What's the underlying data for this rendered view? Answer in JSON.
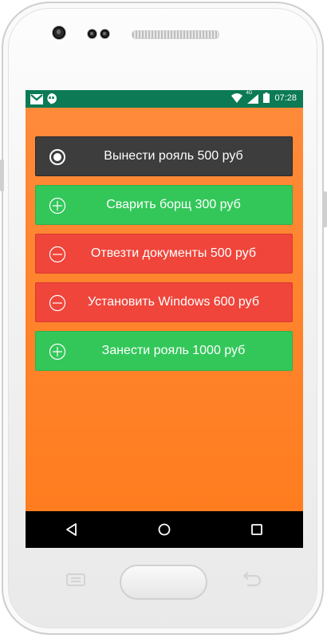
{
  "statusbar": {
    "time": "07:28",
    "network": "4G",
    "left_icons": [
      "gmail-icon",
      "hangouts-icon"
    ],
    "right_icons": [
      "wifi-icon",
      "signal-icon",
      "battery-icon"
    ]
  },
  "items": [
    {
      "label": "Вынести рояль 500 руб",
      "style": "dark",
      "icon": "radio-selected-icon"
    },
    {
      "label": "Сварить борщ 300 руб",
      "style": "green",
      "icon": "plus-circle-icon"
    },
    {
      "label": "Отвезти документы 500 руб",
      "style": "red",
      "icon": "minus-circle-icon"
    },
    {
      "label": "Установить Windows 600 руб",
      "style": "red",
      "icon": "minus-circle-icon"
    },
    {
      "label": "Занести рояль 1000 руб",
      "style": "green",
      "icon": "plus-circle-icon"
    }
  ],
  "navbar": [
    "back-icon",
    "home-icon",
    "recents-icon"
  ],
  "colors": {
    "statusbar": "#0b7a55",
    "background": "#ff8a3a",
    "dark": "#3d3d3d",
    "green": "#33c75a",
    "red": "#ef453b"
  }
}
